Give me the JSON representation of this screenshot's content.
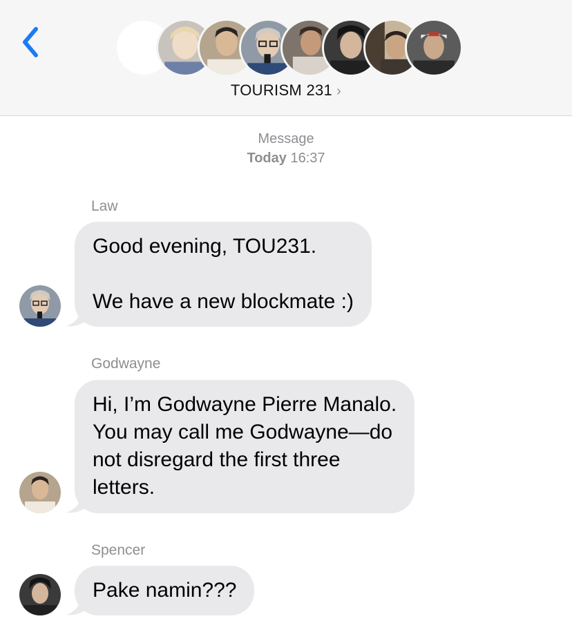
{
  "header": {
    "group_name": "TOURISM 231",
    "chevron": "›",
    "back_icon": "chevron-left-icon",
    "accent_color": "#1a7cf5"
  },
  "timestamp": {
    "label": "Message",
    "day": "Today",
    "time": "16:37"
  },
  "messages": [
    {
      "sender": "Law",
      "lines": [
        "Good evening, TOU231.",
        "",
        "We have a new blockmate :)"
      ]
    },
    {
      "sender": "Godwayne",
      "lines": [
        "Hi, I’m Godwayne Pierre Manalo.",
        "You may call me Godwayne—do",
        "not disregard the first three",
        "letters."
      ]
    },
    {
      "sender": "Spencer",
      "lines": [
        "Pake namin???"
      ]
    }
  ],
  "colors": {
    "bubble": "#e9e9eb",
    "secondary_text": "#8e8e93",
    "header_bg": "#f6f6f6"
  }
}
